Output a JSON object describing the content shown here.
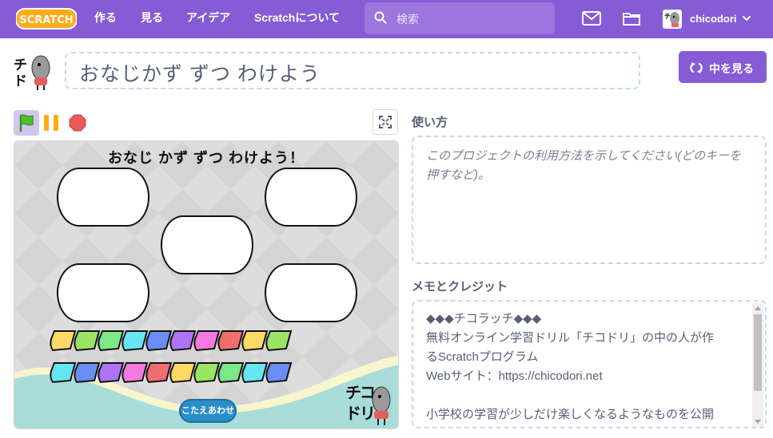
{
  "menubar": {
    "logo_text": "SCRATCH",
    "nav": [
      "作る",
      "見る",
      "アイデア",
      "Scratchについて"
    ],
    "search_placeholder": "検索",
    "username": "chicodori"
  },
  "project": {
    "title": "おなじかず ずつ わけよう",
    "see_inside_label": "中を見る"
  },
  "stage": {
    "title_text": "おなじ かず ずつ わけよう！",
    "answer_button": "こたえあわせ",
    "logo_text": "チコドリ"
  },
  "instructions": {
    "label": "使い方",
    "placeholder": "このプロジェクトの利用方法を示してください(どのキーを押すなど)。"
  },
  "notes": {
    "label": "メモとクレジット",
    "lines": [
      "◆◆◆チコラッチ◆◆◆",
      "無料オンライン学習ドリル「チコドリ」の中の人が作",
      "るScratchプログラム",
      "Webサイト：https://chicodori.net",
      "",
      "小学校の学習が少しだけ楽しくなるようなものを公開"
    ]
  },
  "colors": {
    "brand": "#855cd6",
    "stage_blue": "#2a8fc9",
    "tile_colors": [
      "#ffd966",
      "#9be564",
      "#7ee787",
      "#66e6f2",
      "#6a8cf5",
      "#b072f5",
      "#f57ae0",
      "#f26d6d",
      "#ffd966",
      "#9be564",
      "#7ee787",
      "#66e6f2",
      "#6a8cf5",
      "#b072f5",
      "#f57ae0",
      "#f26d6d"
    ]
  }
}
